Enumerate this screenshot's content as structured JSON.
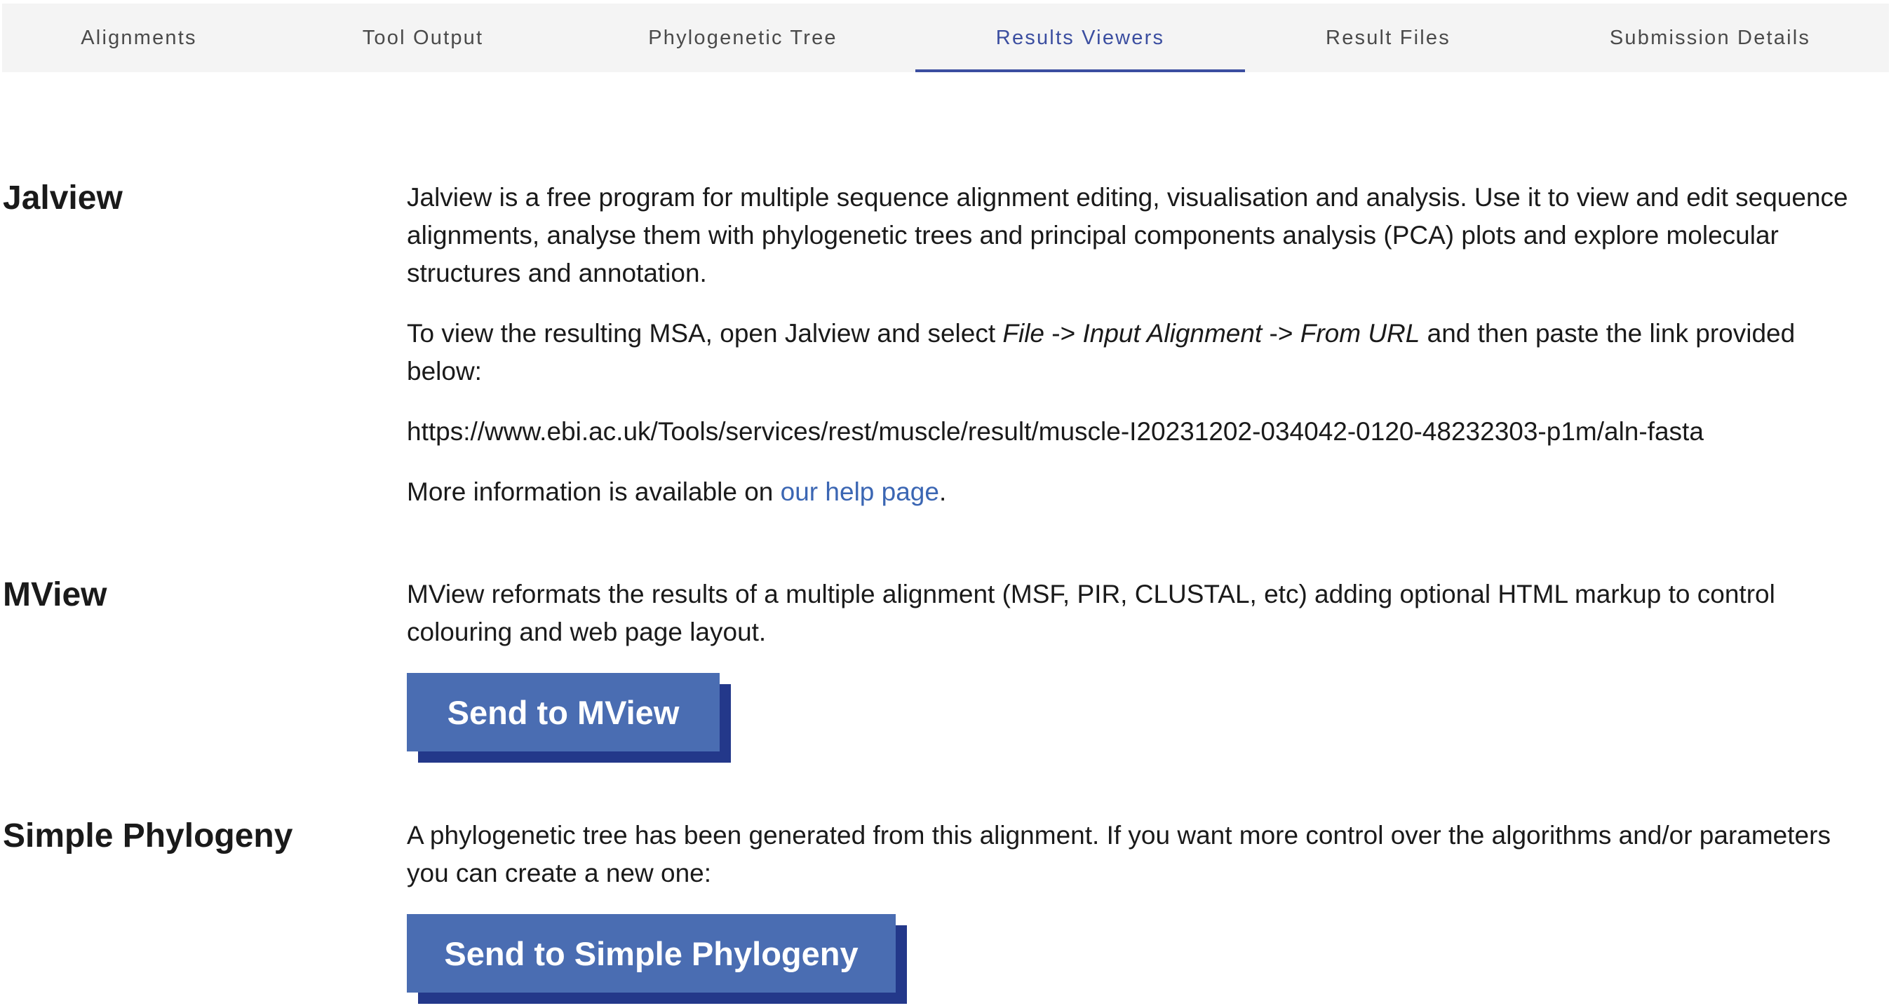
{
  "tabs": [
    {
      "label": "Alignments"
    },
    {
      "label": "Tool Output"
    },
    {
      "label": "Phylogenetic Tree"
    },
    {
      "label": "Results Viewers",
      "active": true
    },
    {
      "label": "Result Files"
    },
    {
      "label": "Submission Details"
    }
  ],
  "jalview": {
    "title": "Jalview",
    "description": "Jalview is a free program for multiple sequence alignment editing, visualisation and analysis. Use it to view and edit sequence alignments, analyse them with phylogenetic trees and principal components analysis (PCA) plots and explore molecular structures and annotation.",
    "instructions_prefix": "To view the resulting MSA, open Jalview and select ",
    "menu_path_1": "File",
    "menu_sep_1": " -> ",
    "menu_path_2": "Input Alignment",
    "menu_sep_2": " -> ",
    "menu_path_3": "From URL",
    "instructions_suffix": " and then paste the link provided below:",
    "url": "https://www.ebi.ac.uk/Tools/services/rest/muscle/result/muscle-I20231202-034042-0120-48232303-p1m/aln-fasta",
    "more_info_prefix": "More information is available on ",
    "more_info_link": "our help page",
    "more_info_suffix": "."
  },
  "mview": {
    "title": "MView",
    "description": "MView reformats the results of a multiple alignment (MSF, PIR, CLUSTAL, etc) adding optional HTML markup to control colouring and web page layout.",
    "button_label": "Send to MView"
  },
  "simple_phylogeny": {
    "title": "Simple Phylogeny",
    "description": "A phylogenetic tree has been generated from this alignment. If you want more control over the algorithms and/or parameters you can create a new one:",
    "button_label": "Send to Simple Phylogeny"
  },
  "colors": {
    "accent": "#3b4ea0",
    "link": "#3b66b3",
    "button": "#4a6db2",
    "button_shadow": "#23388a",
    "tab_bar": "#f4f4f4"
  }
}
